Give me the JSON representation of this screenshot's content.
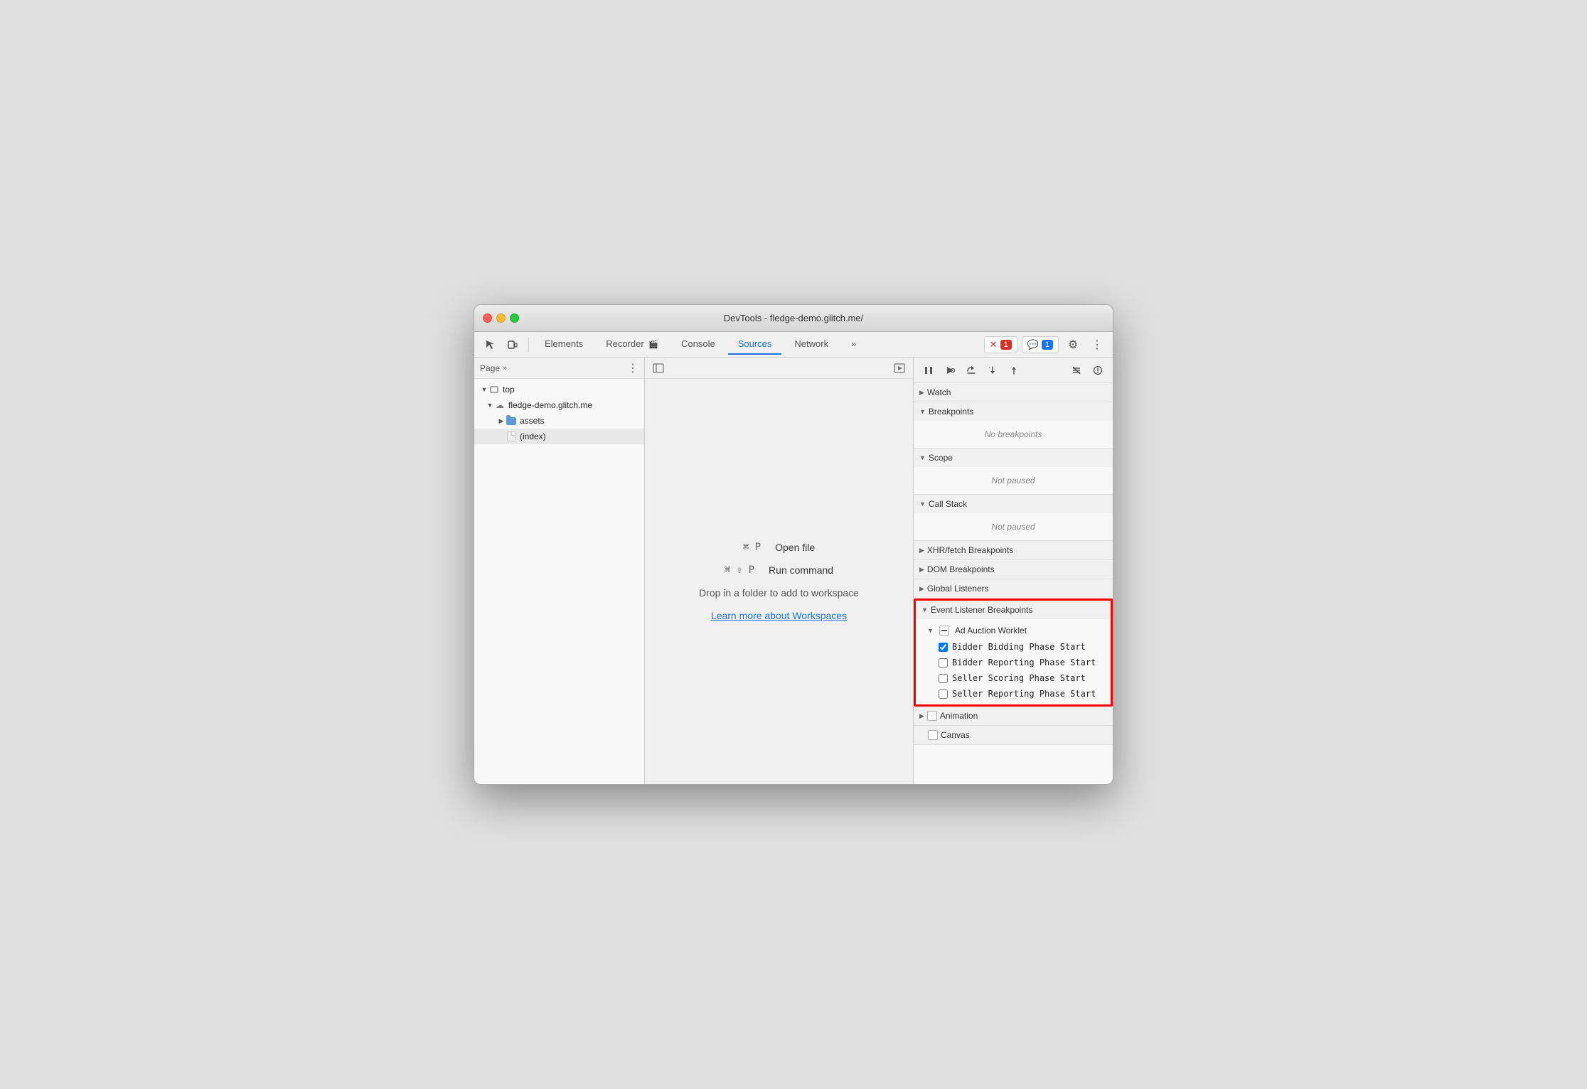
{
  "window": {
    "title": "DevTools - fledge-demo.glitch.me/"
  },
  "titlebar": {
    "traffic_lights": [
      "red",
      "yellow",
      "green"
    ]
  },
  "toolbar": {
    "tabs": [
      "Elements",
      "Recorder",
      "Console",
      "Sources",
      "Network"
    ],
    "active_tab": "Sources",
    "more_tabs_label": "»",
    "errors_count": "1",
    "messages_count": "1",
    "settings_icon": "⚙",
    "more_icon": "⋮"
  },
  "left_panel": {
    "header_title": "Page",
    "header_more": "»",
    "header_dots": "⋮",
    "tree": [
      {
        "label": "top",
        "level": 0,
        "type": "arrow",
        "expanded": true
      },
      {
        "label": "fledge-demo.glitch.me",
        "level": 1,
        "type": "cloud",
        "expanded": true
      },
      {
        "label": "assets",
        "level": 2,
        "type": "folder",
        "expanded": false
      },
      {
        "label": "(index)",
        "level": 2,
        "type": "file",
        "selected": true
      }
    ]
  },
  "center_panel": {
    "shortcut1_key": "⌘ P",
    "shortcut1_action": "Open file",
    "shortcut2_key": "⌘ ⇧ P",
    "shortcut2_action": "Run command",
    "drop_text": "Drop in a folder to add to workspace",
    "workspace_link": "Learn more about Workspaces"
  },
  "right_panel": {
    "debugger_buttons": [
      "pause",
      "resume",
      "step-over",
      "step-into",
      "step-out",
      "deactivate-breakpoints",
      "pause-on-exceptions"
    ],
    "sections": [
      {
        "id": "watch",
        "label": "Watch",
        "collapsed": true,
        "items": []
      },
      {
        "id": "breakpoints",
        "label": "Breakpoints",
        "collapsed": false,
        "empty_text": "No breakpoints"
      },
      {
        "id": "scope",
        "label": "Scope",
        "collapsed": false,
        "empty_text": "Not paused"
      },
      {
        "id": "call-stack",
        "label": "Call Stack",
        "collapsed": false,
        "empty_text": "Not paused"
      },
      {
        "id": "xhr-fetch",
        "label": "XHR/fetch Breakpoints",
        "collapsed": true
      },
      {
        "id": "dom-breakpoints",
        "label": "DOM Breakpoints",
        "collapsed": true
      },
      {
        "id": "global-listeners",
        "label": "Global Listeners",
        "collapsed": true
      },
      {
        "id": "event-listener-breakpoints",
        "label": "Event Listener Breakpoints",
        "highlighted": true,
        "collapsed": false,
        "subsections": [
          {
            "id": "ad-auction-worklet",
            "label": "Ad Auction Worklet",
            "expanded": true,
            "items": [
              {
                "label": "Bidder Bidding Phase Start",
                "checked": true
              },
              {
                "label": "Bidder Reporting Phase Start",
                "checked": false
              },
              {
                "label": "Seller Scoring Phase Start",
                "checked": false
              },
              {
                "label": "Seller Reporting Phase Start",
                "checked": false
              }
            ]
          }
        ]
      },
      {
        "id": "animation",
        "label": "Animation",
        "collapsed": true
      },
      {
        "id": "canvas",
        "label": "Canvas",
        "collapsed": false
      }
    ]
  }
}
